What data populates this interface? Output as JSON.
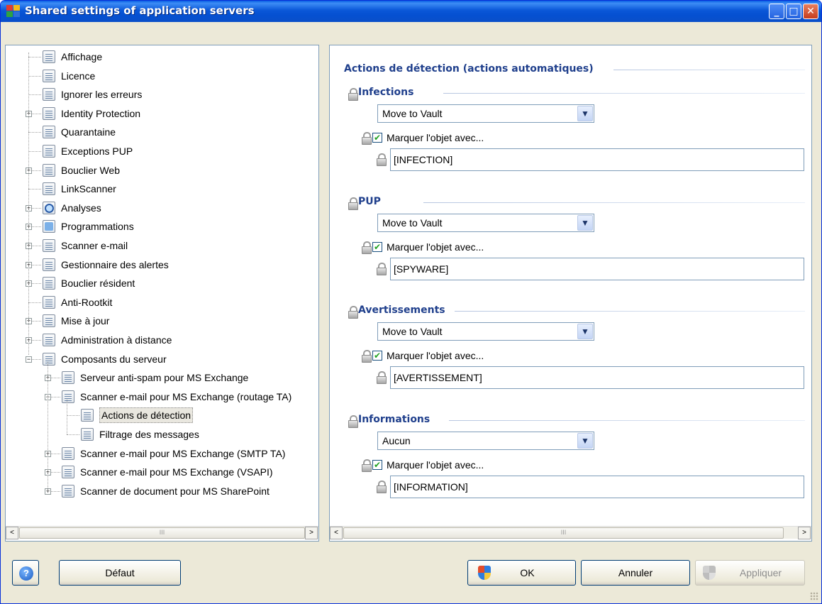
{
  "window": {
    "title": "Shared settings of application servers",
    "controls": {
      "minimize": "_",
      "maximize": "□",
      "close": "✕"
    }
  },
  "tree": {
    "items": [
      {
        "label": "Affichage",
        "icon": "document-icon"
      },
      {
        "label": "Licence",
        "icon": "document-icon"
      },
      {
        "label": "Ignorer les erreurs",
        "icon": "document-icon"
      },
      {
        "label": "Identity Protection",
        "icon": "document-icon",
        "expander": "+"
      },
      {
        "label": "Quarantaine",
        "icon": "document-icon"
      },
      {
        "label": "Exceptions PUP",
        "icon": "document-icon"
      },
      {
        "label": "Bouclier Web",
        "icon": "document-icon",
        "expander": "+"
      },
      {
        "label": "LinkScanner",
        "icon": "document-icon"
      },
      {
        "label": "Analyses",
        "icon": "magnifier-icon",
        "expander": "+"
      },
      {
        "label": "Programmations",
        "icon": "calendar-icon",
        "expander": "+"
      },
      {
        "label": "Scanner e-mail",
        "icon": "document-icon",
        "expander": "+"
      },
      {
        "label": "Gestionnaire des alertes",
        "icon": "document-icon",
        "expander": "+"
      },
      {
        "label": "Bouclier résident",
        "icon": "document-icon",
        "expander": "+"
      },
      {
        "label": "Anti-Rootkit",
        "icon": "document-icon"
      },
      {
        "label": "Mise à jour",
        "icon": "document-icon",
        "expander": "+"
      },
      {
        "label": "Administration à distance",
        "icon": "document-icon",
        "expander": "+"
      },
      {
        "label": "Composants du serveur",
        "icon": "document-icon",
        "expander": "−"
      },
      {
        "label": "Serveur anti-spam pour MS Exchange",
        "icon": "document-icon",
        "expander": "+"
      },
      {
        "label": "Scanner e-mail pour MS Exchange (routage TA)",
        "icon": "document-icon",
        "expander": "−"
      },
      {
        "label": "Actions de détection",
        "icon": "document-icon",
        "selected": true
      },
      {
        "label": "Filtrage des messages",
        "icon": "document-icon"
      },
      {
        "label": "Scanner e-mail pour MS Exchange (SMTP TA)",
        "icon": "document-icon",
        "expander": "+"
      },
      {
        "label": "Scanner e-mail pour MS Exchange (VSAPI)",
        "icon": "document-icon",
        "expander": "+"
      },
      {
        "label": "Scanner de document pour MS SharePoint",
        "icon": "document-icon",
        "expander": "+"
      }
    ]
  },
  "scrollbar": {
    "left_arrow": "<",
    "right_arrow": ">",
    "thumb_grip": "III"
  },
  "panel": {
    "heading": "Actions de détection (actions automatiques)",
    "groups": [
      {
        "title": "Infections",
        "action": "Move to Vault",
        "checkbox_label": "Marquer l'objet avec...",
        "checked": true,
        "tag": "[INFECTION]"
      },
      {
        "title": "PUP",
        "action": "Move to Vault",
        "checkbox_label": "Marquer l'objet avec...",
        "checked": true,
        "tag": "[SPYWARE]"
      },
      {
        "title": "Avertissements",
        "action": "Move to Vault",
        "checkbox_label": "Marquer l'objet avec...",
        "checked": true,
        "tag": "[AVERTISSEMENT]"
      },
      {
        "title": "Informations",
        "action": "Aucun",
        "checkbox_label": "Marquer l'objet avec...",
        "checked": true,
        "tag": "[INFORMATION]"
      }
    ]
  },
  "footer": {
    "help_glyph": "?",
    "default_label": "Défaut",
    "ok_label": "OK",
    "cancel_label": "Annuler",
    "apply_label": "Appliquer"
  },
  "colors": {
    "titlebar": "#0a57d8",
    "group_title": "#1f3f8c",
    "window_bg": "#ece9d8"
  }
}
